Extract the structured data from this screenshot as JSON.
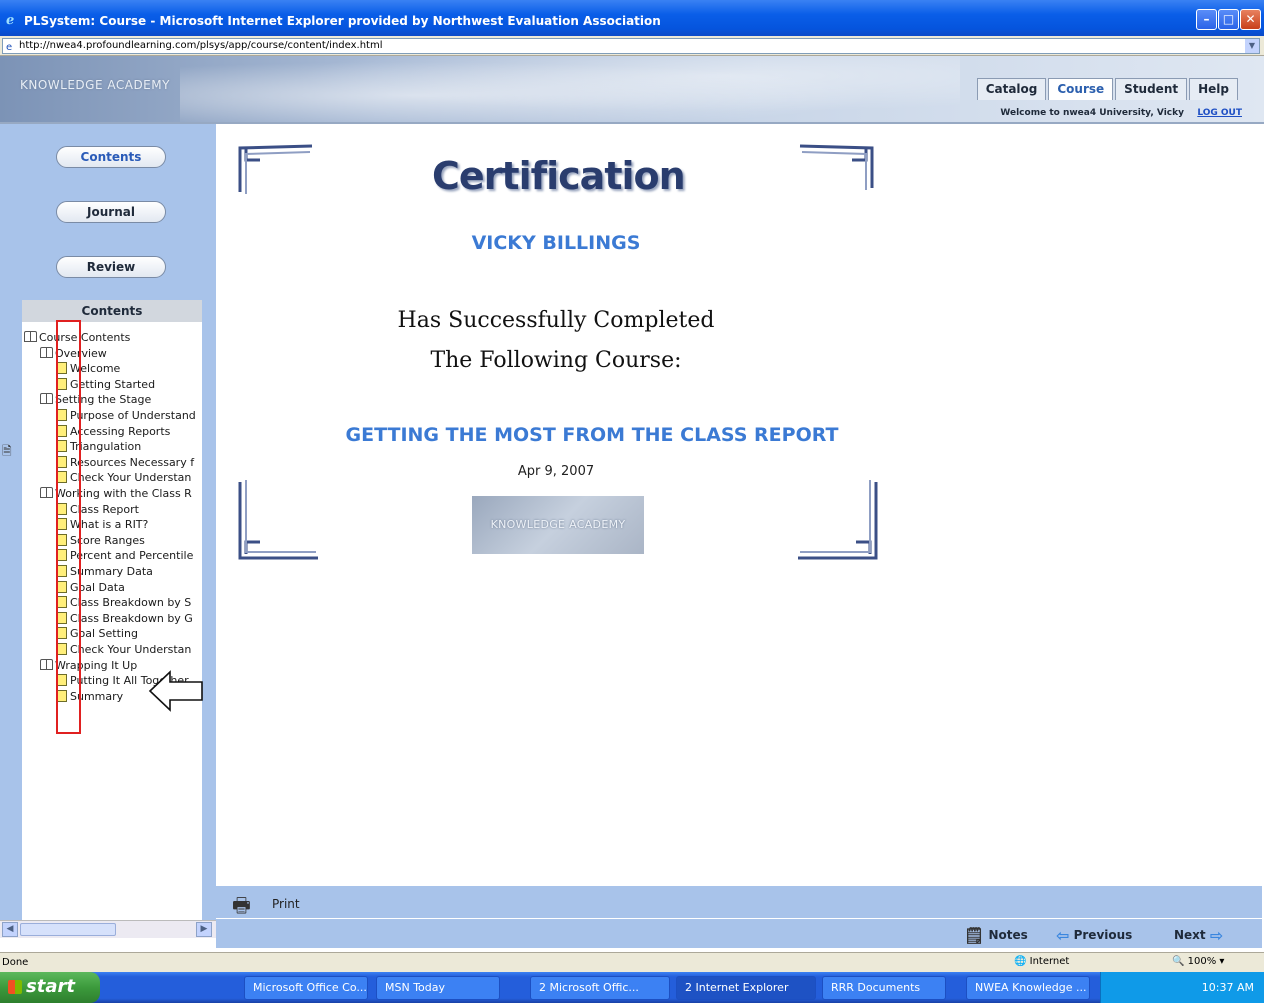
{
  "window": {
    "title": "PLSystem: Course - Microsoft Internet Explorer provided by Northwest Evaluation Association",
    "address": "http://nwea4.profoundlearning.com/plsys/app/course/content/index.html"
  },
  "header": {
    "brand": "KNOWLEDGE ACADEMY",
    "tabs": [
      "Catalog",
      "Course",
      "Student",
      "Help"
    ],
    "active_tab": "Course",
    "welcome": "Welcome to nwea4 University, Vicky",
    "logout": "LOG OUT"
  },
  "sidebar": {
    "buttons": {
      "contents": "Contents",
      "journal": "Journal",
      "review": "Review"
    },
    "toc_title": "Contents",
    "toc": [
      {
        "label": "Course Contents",
        "type": "book",
        "level": 0
      },
      {
        "label": "Overview",
        "type": "book",
        "level": 1
      },
      {
        "label": "Welcome",
        "type": "page",
        "level": 2
      },
      {
        "label": "Getting Started",
        "type": "page",
        "level": 2
      },
      {
        "label": "Setting the Stage",
        "type": "book",
        "level": 1
      },
      {
        "label": "Purpose of Understand",
        "type": "page",
        "level": 2
      },
      {
        "label": "Accessing Reports",
        "type": "page",
        "level": 2
      },
      {
        "label": "Triangulation",
        "type": "page",
        "level": 2
      },
      {
        "label": "Resources Necessary f",
        "type": "page",
        "level": 2
      },
      {
        "label": "Check Your Understan",
        "type": "page",
        "level": 2
      },
      {
        "label": "Working with the Class R",
        "type": "book",
        "level": 1
      },
      {
        "label": "Class Report",
        "type": "page",
        "level": 2
      },
      {
        "label": "What is a RIT?",
        "type": "page",
        "level": 2
      },
      {
        "label": "Score Ranges",
        "type": "page",
        "level": 2
      },
      {
        "label": "Percent and Percentile",
        "type": "page",
        "level": 2
      },
      {
        "label": "Summary Data",
        "type": "page",
        "level": 2
      },
      {
        "label": "Goal Data",
        "type": "page",
        "level": 2
      },
      {
        "label": "Class Breakdown by S",
        "type": "page",
        "level": 2
      },
      {
        "label": "Class Breakdown by G",
        "type": "page",
        "level": 2
      },
      {
        "label": "Goal Setting",
        "type": "page",
        "level": 2
      },
      {
        "label": "Check Your Understan",
        "type": "page",
        "level": 2
      },
      {
        "label": "Wrapping It Up",
        "type": "book",
        "level": 1
      },
      {
        "label": "Putting It All Together",
        "type": "page",
        "level": 2
      },
      {
        "label": "Summary",
        "type": "page",
        "level": 2
      }
    ]
  },
  "certificate": {
    "title": "Certification",
    "name": "VICKY BILLINGS",
    "line1": "Has Successfully Completed",
    "line2": "The Following Course:",
    "course": "GETTING THE MOST FROM THE CLASS REPORT",
    "date": "Apr 9, 2007",
    "logo": "KNOWLEDGE ACADEMY"
  },
  "footer": {
    "print": "Print",
    "notes": "Notes",
    "previous": "Previous",
    "next": "Next"
  },
  "status": {
    "text": "Done",
    "zone": "Internet",
    "zoom": "100%"
  },
  "taskbar": {
    "start": "start",
    "tasks": [
      "Microsoft Office Co...",
      "MSN Today",
      "2 Microsoft Offic...",
      "2 Internet Explorer",
      "RRR Documents",
      "NWEA Knowledge ..."
    ],
    "clock": "10:37 AM"
  }
}
